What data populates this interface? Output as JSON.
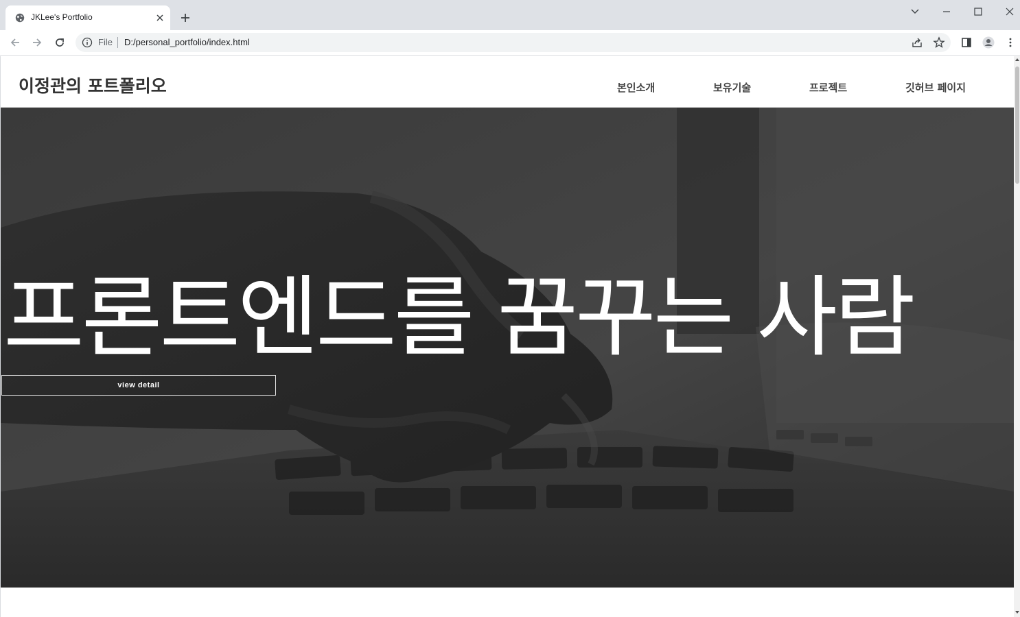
{
  "browser": {
    "tab_title": "JKLee's Portfolio",
    "url_scheme": "File",
    "url": "D:/personal_portfolio/index.html"
  },
  "site": {
    "logo": "이정관의 포트폴리오",
    "nav": [
      "본인소개",
      "보유기술",
      "프로젝트",
      "깃허브 페이지"
    ]
  },
  "hero": {
    "title": "프론트엔드를 꿈꾸는 사람",
    "button": "view detail"
  },
  "colors": {
    "chrome_tabstrip": "#dee1e6",
    "hero_overlay": "#3d3d3d",
    "text_white": "#ffffff"
  }
}
